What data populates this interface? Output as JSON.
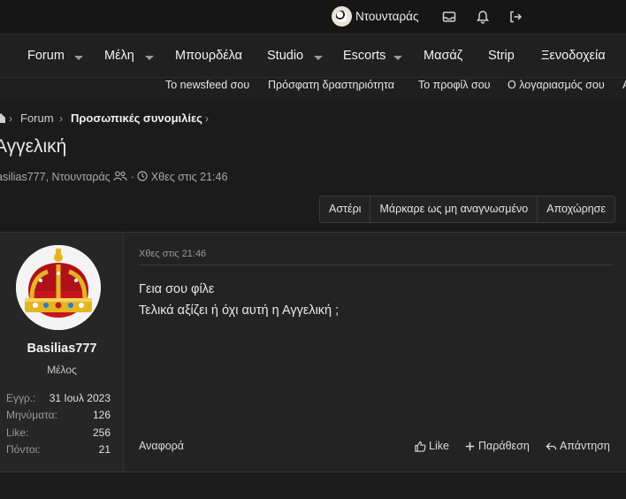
{
  "topbar": {
    "username": "Ντουνταράς",
    "icons": [
      "inbox-icon",
      "bell-icon",
      "logout-icon"
    ]
  },
  "nav": {
    "items": [
      {
        "label": "Forum",
        "dropdown": true
      },
      {
        "label": "Μέλη",
        "dropdown": true
      },
      {
        "label": "Μπουρδέλα",
        "dropdown": false
      },
      {
        "label": "Studio",
        "dropdown": true
      },
      {
        "label": "Escorts",
        "dropdown": true
      },
      {
        "label": "Μασάζ",
        "dropdown": false
      },
      {
        "label": "Strip",
        "dropdown": false
      },
      {
        "label": "Ξενοδοχεία",
        "dropdown": false
      }
    ]
  },
  "subnav": {
    "items": [
      "Το newsfeed σου",
      "Πρόσφατη δραστηριότητα",
      "Το προφίλ σου",
      "Ο λογαριασμός σου",
      "A"
    ]
  },
  "breadcrumb": {
    "items": [
      "Forum",
      "Προσωπικές συνομιλίες"
    ]
  },
  "thread": {
    "title": "Αγγελική",
    "participants": "asilias777, Ντουνταράς",
    "timestamp": "Χθες στις 21:46"
  },
  "actions": [
    "Αστέρι",
    "Μάρκαρε ως μη αναγνωσμένο",
    "Αποχώρησε"
  ],
  "message": {
    "author": "Basilias777",
    "author_title": "Μέλος",
    "stats": [
      {
        "key": "Εγγρ.:",
        "value": "31 Ιουλ 2023"
      },
      {
        "key": "Μηνύματα:",
        "value": "126"
      },
      {
        "key": "Like:",
        "value": "256"
      },
      {
        "key": "Πόντοι:",
        "value": "21"
      }
    ],
    "date": "Χθες στις 21:46",
    "lines": [
      "Γεια σου φίλε",
      "Τελικά αξίζει ή όχι αυτή η Αγγελική ;"
    ],
    "report_label": "Αναφορά",
    "like_label": "Like",
    "quote_label": "Παράθεση",
    "reply_label": "Απάντηση"
  }
}
